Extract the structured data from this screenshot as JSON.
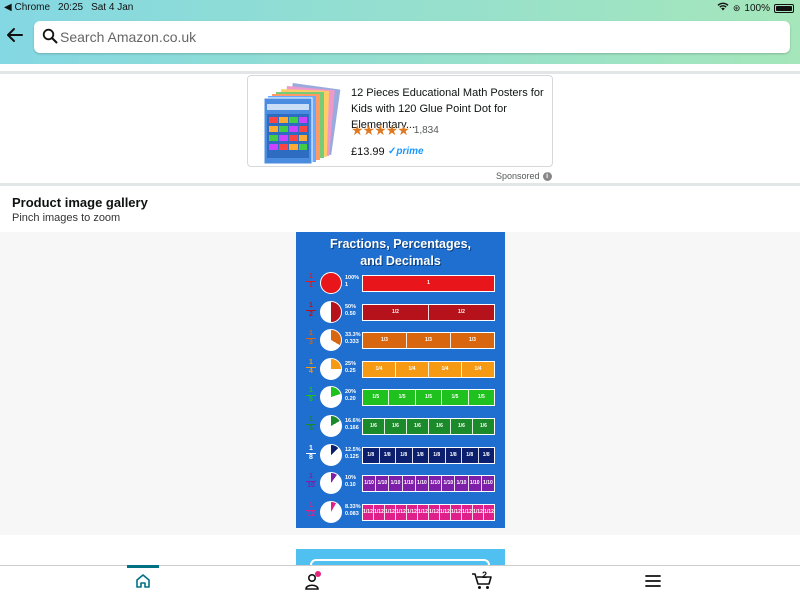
{
  "status_bar": {
    "app": "◀ Chrome",
    "time": "20:25",
    "date": "Sat 4 Jan",
    "battery": "100%"
  },
  "search": {
    "placeholder": "Search Amazon.co.uk"
  },
  "ad": {
    "title": "12 Pieces Educational Math Posters for Kids with 120 Glue Point Dot for Elementary...",
    "stars": "★★★★★",
    "rating_value": 4.5,
    "review_count": "1,834",
    "price": "£13.99",
    "prime_label": "prime",
    "sponsored": "Sponsored",
    "info_icon": "i"
  },
  "gallery": {
    "title": "Product image gallery",
    "subtitle": "Pinch images to zoom"
  },
  "poster": {
    "heading_line1": "Fractions, Percentages,",
    "heading_line2": "and Decimals",
    "rows": [
      {
        "frac_top": "1",
        "frac_bottom": "1",
        "pct": "100%",
        "dec": "1",
        "color": "#e8161b",
        "pie_color": "#e8161b",
        "unit": "1",
        "parts": 1
      },
      {
        "frac_top": "1",
        "frac_bottom": "2",
        "pct": "50%",
        "dec": "0.50",
        "color": "#b5121b",
        "pie_color": "#b5121b",
        "unit": "1/2",
        "parts": 2
      },
      {
        "frac_top": "1",
        "frac_bottom": "3",
        "pct": "33.3%",
        "dec": "0.333",
        "color": "#d7660f",
        "pie_color": "#d7660f",
        "unit": "1/3",
        "parts": 3
      },
      {
        "frac_top": "1",
        "frac_bottom": "4",
        "pct": "25%",
        "dec": "0.25",
        "color": "#f59a12",
        "pie_color": "#f59a12",
        "unit": "1/4",
        "parts": 4
      },
      {
        "frac_top": "1",
        "frac_bottom": "5",
        "pct": "20%",
        "dec": "0.20",
        "color": "#1fc11f",
        "pie_color": "#1fc11f",
        "unit": "1/5",
        "parts": 5
      },
      {
        "frac_top": "1",
        "frac_bottom": "6",
        "pct": "16.6%",
        "dec": "0.166",
        "color": "#1a8a2a",
        "pie_color": "#1a8a2a",
        "unit": "1/6",
        "parts": 6
      },
      {
        "frac_top": "1",
        "frac_bottom": "8",
        "pct": "12.5%",
        "dec": "0.125",
        "color": "#0b1f6e",
        "pie_color": "#0b1f6e",
        "unit": "1/8",
        "parts": 8
      },
      {
        "frac_top": "1",
        "frac_bottom": "10",
        "pct": "10%",
        "dec": "0.10",
        "color": "#7d1fa8",
        "pie_color": "#7d1fa8",
        "unit": "1/10",
        "parts": 10
      },
      {
        "frac_top": "1",
        "frac_bottom": "12",
        "pct": "8.33%",
        "dec": "0.083",
        "color": "#e0208a",
        "pie_color": "#e0208a",
        "unit": "1/12",
        "parts": 12
      }
    ]
  },
  "bottom_nav": {
    "items": [
      "home-icon",
      "account-icon",
      "cart-icon",
      "menu-icon"
    ],
    "cart_count": "2",
    "accent": "#007185"
  }
}
